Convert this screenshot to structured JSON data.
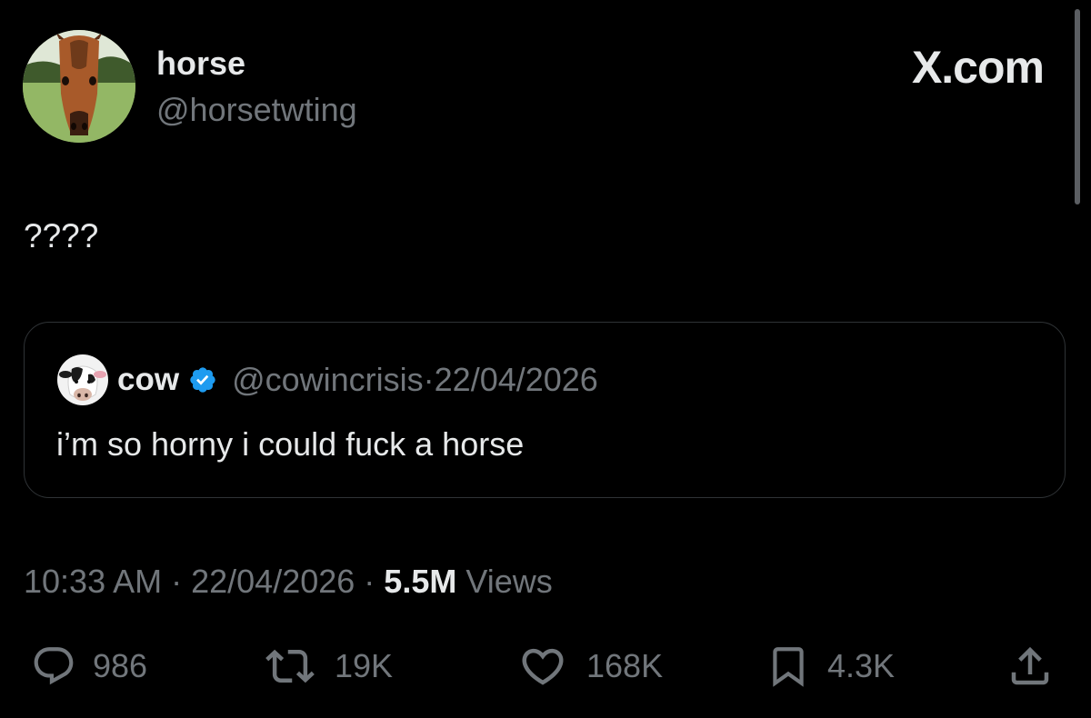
{
  "author": {
    "display_name": "horse",
    "handle": "@horsetwting",
    "avatar_icon": "horse-avatar-icon"
  },
  "brand": "X.com",
  "tweet": {
    "text": "????"
  },
  "quoted_tweet": {
    "display_name": "cow",
    "verified": true,
    "handle": "@cowincrisis",
    "separator": " · ",
    "date": "22/04/2026",
    "text": "i’m so horny i could fuck a horse",
    "avatar_icon": "cow-avatar-icon"
  },
  "meta": {
    "time": "10:33 AM",
    "separator": " · ",
    "date": "22/04/2026",
    "views_count": "5.5M",
    "views_label": "Views"
  },
  "actions": {
    "replies": "986",
    "reposts": "19K",
    "likes": "168K",
    "bookmarks": "4.3K"
  },
  "colors": {
    "background": "#000000",
    "primary_text": "#e7e9ea",
    "secondary_text": "#71767b",
    "border": "#2f3336",
    "verified_blue": "#1d9bf0"
  }
}
